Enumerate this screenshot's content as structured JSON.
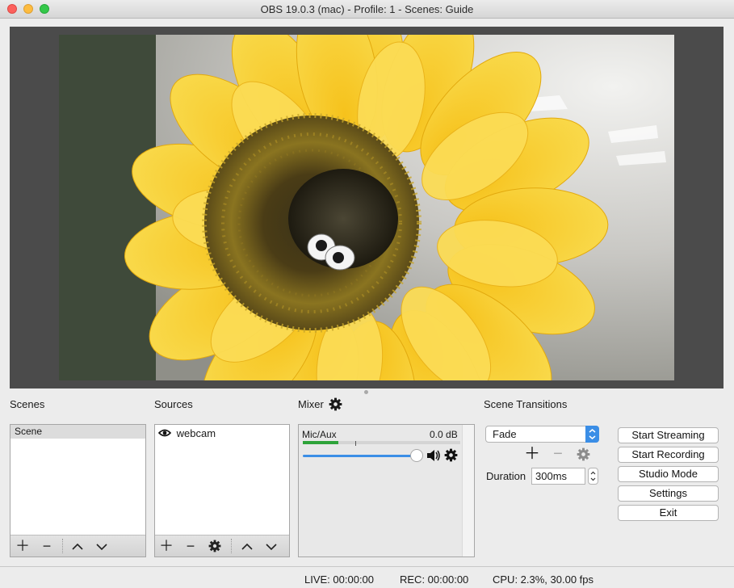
{
  "window": {
    "title": "OBS 19.0.3 (mac) - Profile: 1 - Scenes: Guide"
  },
  "docks": {
    "scenes": "Scenes",
    "sources": "Sources",
    "mixer": "Mixer",
    "transitions": "Scene Transitions"
  },
  "scenes": {
    "items": [
      "Scene"
    ]
  },
  "sources": {
    "items": [
      {
        "name": "webcam",
        "visible": true
      }
    ]
  },
  "mixer": {
    "channel": "Mic/Aux",
    "level": "0.0 dB",
    "volume": 1.0
  },
  "transitions": {
    "selected": "Fade",
    "duration_label": "Duration",
    "duration_value": "300ms"
  },
  "controls": {
    "start_streaming": "Start Streaming",
    "start_recording": "Start Recording",
    "studio_mode": "Studio Mode",
    "settings": "Settings",
    "exit": "Exit"
  },
  "status": {
    "live": "LIVE: 00:00:00",
    "rec": "REC: 00:00:00",
    "cpu": "CPU: 2.3%, 30.00 fps"
  },
  "colors": {
    "accent": "#3b8ee6",
    "meter_green": "#2ea33a",
    "preview_bg": "#4b4b4b"
  }
}
